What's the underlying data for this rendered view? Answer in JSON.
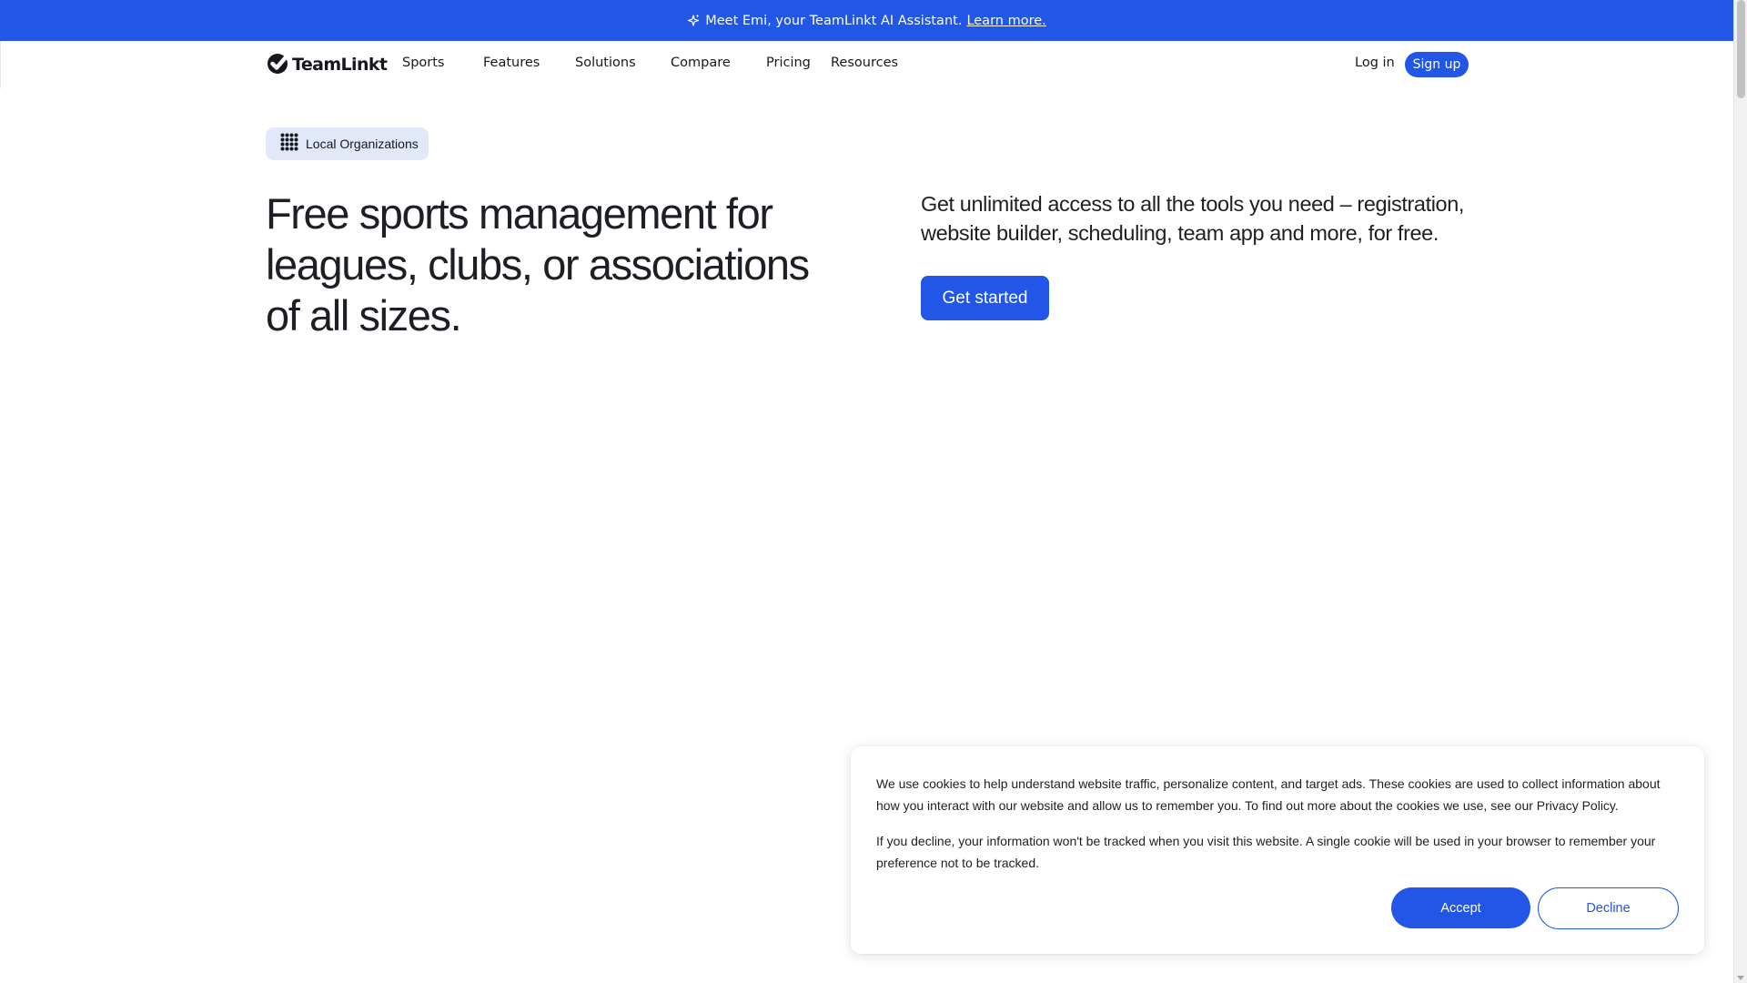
{
  "announcement": {
    "text": "Meet Emi, your TeamLinkt AI Assistant.",
    "link_label": "Learn more.",
    "icon": "sparkle-icon"
  },
  "nav": {
    "logo_text": "TeamLinkt",
    "logo_icon": "check-circle-icon",
    "items": [
      {
        "label": "Sports"
      },
      {
        "label": "Features"
      },
      {
        "label": "Solutions"
      },
      {
        "label": "Compare"
      },
      {
        "label": "Pricing"
      },
      {
        "label": "Resources"
      }
    ],
    "login_label": "Log in",
    "signup_label": "Sign up"
  },
  "hero": {
    "badge_icon": "grid-dots-icon",
    "badge_label": "Local Organizations",
    "title": "Free sports management for leagues, clubs, or associations of all sizes.",
    "subtitle": "Get unlimited access to all the tools you need – registration, website builder, scheduling, team app and more, for free.",
    "cta_label": "Get started"
  },
  "cookie_banner": {
    "paragraph_1": "We use cookies to help understand website traffic, personalize content, and target ads. These cookies are used to collect information about how you interact with our website and allow us to remember you. To find out more about the cookies we use, see our Privacy Policy.",
    "paragraph_2": "If you decline, your information won't be tracked when you visit this website. A single cookie will be used in your browser to remember your preference not to be tracked.",
    "accept_label": "Accept",
    "decline_label": "Decline"
  },
  "colors": {
    "brand_blue": "#2156e6",
    "badge_bg": "#e1e8f8",
    "text": "#1c1f24"
  }
}
